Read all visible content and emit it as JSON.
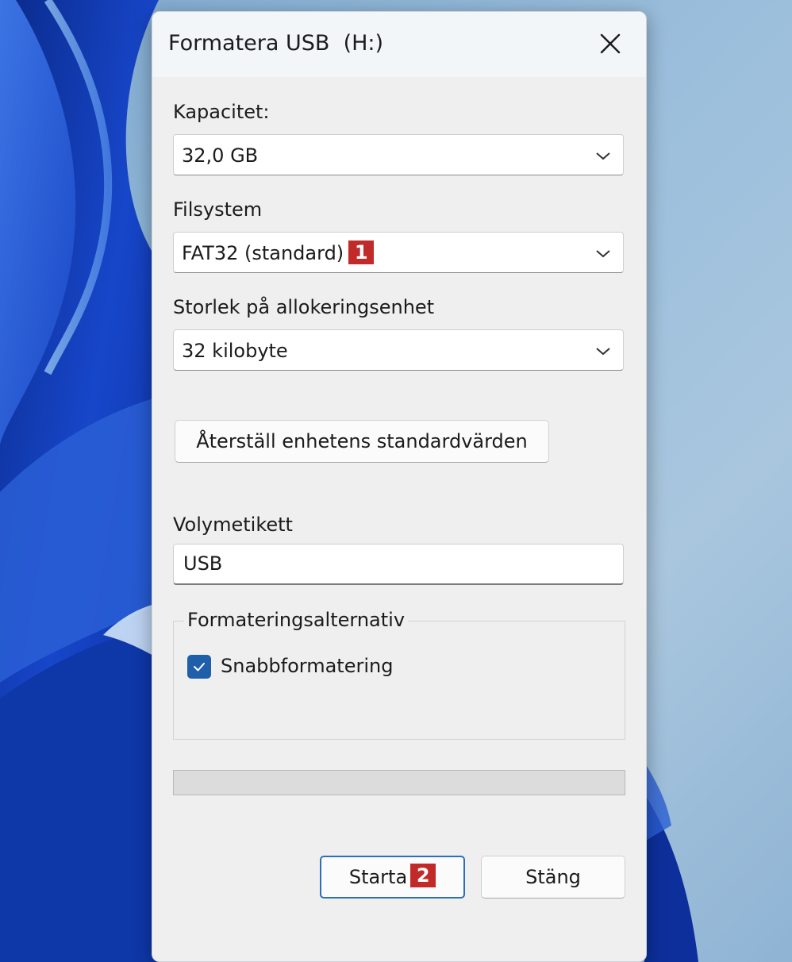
{
  "dialog": {
    "title": "Formatera USB  (H:)",
    "close_icon": "close-icon"
  },
  "capacity": {
    "label": "Kapacitet:",
    "value": "32,0 GB"
  },
  "filesystem": {
    "label": "Filsystem",
    "value": "FAT32 (standard)",
    "marker": "1"
  },
  "allocation": {
    "label": "Storlek på allokeringsenhet",
    "value": "32 kilobyte"
  },
  "restore_button": {
    "label": "Återställ enhetens standardvärden"
  },
  "volume_label": {
    "label": "Volymetikett",
    "value": "USB"
  },
  "format_options": {
    "legend": "Formateringsalternativ",
    "quick_format": {
      "label": "Snabbformatering",
      "checked": true
    }
  },
  "progress": {
    "value": 0
  },
  "buttons": {
    "start": "Starta",
    "start_marker": "2",
    "close": "Stäng"
  },
  "colors": {
    "accent": "#1f5ea8",
    "marker": "#c22a2a"
  }
}
